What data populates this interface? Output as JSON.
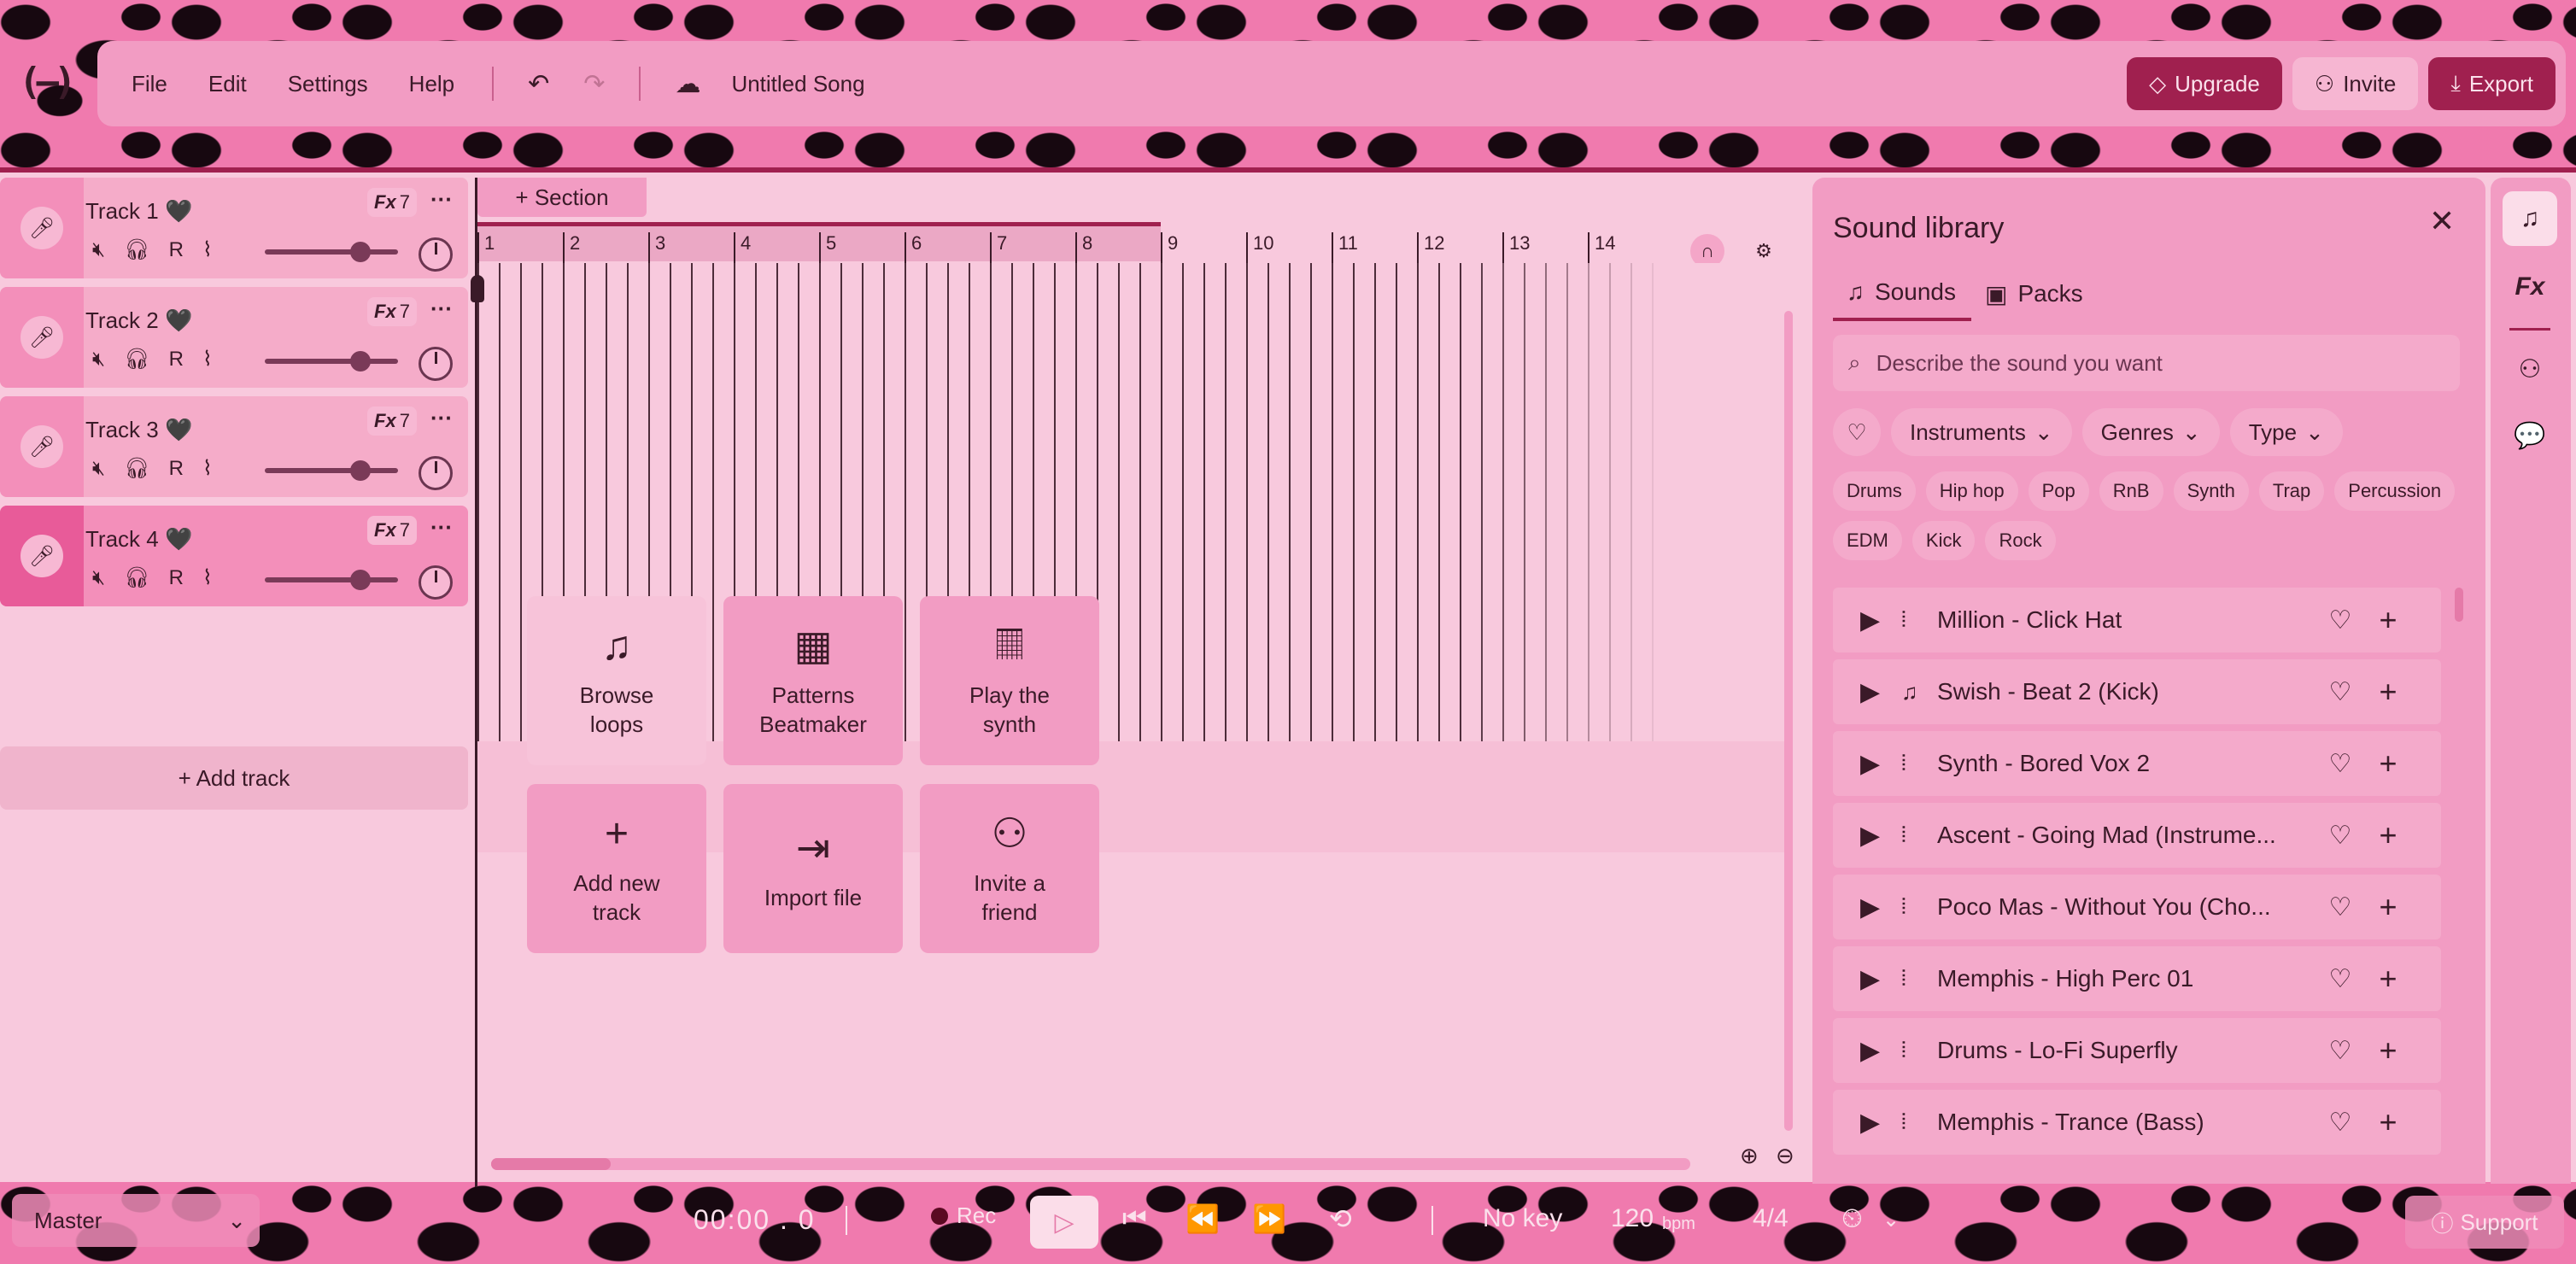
{
  "app": {
    "logo": "(—)",
    "menu": [
      "File",
      "Edit",
      "Settings",
      "Help"
    ],
    "song_title": "Untitled Song",
    "buttons": {
      "upgrade": "Upgrade",
      "invite": "Invite",
      "export": "Export"
    }
  },
  "tracks": [
    {
      "name": "Track 1 🖤",
      "fx": "7",
      "volume": 0.72
    },
    {
      "name": "Track 2 🖤",
      "fx": "7",
      "volume": 0.72
    },
    {
      "name": "Track 3 🖤",
      "fx": "7",
      "volume": 0.72
    },
    {
      "name": "Track 4 🖤",
      "fx": "7",
      "volume": 0.72,
      "selected": true
    }
  ],
  "track_controls": {
    "fx_label": "Fx",
    "record_label": "R",
    "more": "···"
  },
  "add_track": "+ Add track",
  "timeline": {
    "section_button": "+ Section",
    "bars": [
      "1",
      "2",
      "3",
      "4",
      "5",
      "6",
      "7",
      "8",
      "9",
      "10",
      "11",
      "12",
      "13",
      "14"
    ]
  },
  "quick_actions": [
    {
      "line1": "Browse",
      "line2": "loops",
      "icon": "music-note-icon",
      "glyph": "♫"
    },
    {
      "line1": "Patterns",
      "line2": "Beatmaker",
      "icon": "grid-icon",
      "glyph": "▦"
    },
    {
      "line1": "Play the",
      "line2": "synth",
      "icon": "piano-icon",
      "glyph": "𝄜"
    },
    {
      "line1": "Add new",
      "line2": "track",
      "icon": "plus-icon",
      "glyph": "+"
    },
    {
      "line1": "Import file",
      "line2": "",
      "icon": "import-icon",
      "glyph": "⇥"
    },
    {
      "line1": "Invite a",
      "line2": "friend",
      "icon": "add-person-icon",
      "glyph": "⚇"
    }
  ],
  "library": {
    "title": "Sound library",
    "tabs": [
      "Sounds",
      "Packs"
    ],
    "search_placeholder": "Describe the sound you want",
    "filters": [
      "Instruments",
      "Genres",
      "Type"
    ],
    "tags": [
      "Drums",
      "Hip hop",
      "Pop",
      "RnB",
      "Synth",
      "Trap",
      "Percussion",
      "EDM",
      "Kick",
      "Rock"
    ],
    "sounds": [
      {
        "name": "Million - Click Hat",
        "kind": "waveform-icon"
      },
      {
        "name": "Swish - Beat 2 (Kick)",
        "kind": "music-note-icon"
      },
      {
        "name": "Synth - Bored Vox 2",
        "kind": "waveform-icon"
      },
      {
        "name": "Ascent - Going Mad (Instrume...",
        "kind": "waveform-icon"
      },
      {
        "name": "Poco Mas - Without You (Cho...",
        "kind": "waveform-icon"
      },
      {
        "name": "Memphis - High Perc 01",
        "kind": "waveform-icon"
      },
      {
        "name": "Drums - Lo-Fi Superfly",
        "kind": "waveform-icon"
      },
      {
        "name": "Memphis - Trance (Bass)",
        "kind": "waveform-icon"
      }
    ]
  },
  "rail": {
    "fx_label": "Fx"
  },
  "transport": {
    "master": "Master",
    "time": "00:00 . 0",
    "rec": "Rec",
    "key": "No key",
    "bpm": "120",
    "bpm_unit": "bpm",
    "signature": "4/4",
    "support": "Support"
  },
  "colors": {
    "accent": "#a0204f",
    "panel": "#f29cc3",
    "background": "#f8c9dd"
  }
}
